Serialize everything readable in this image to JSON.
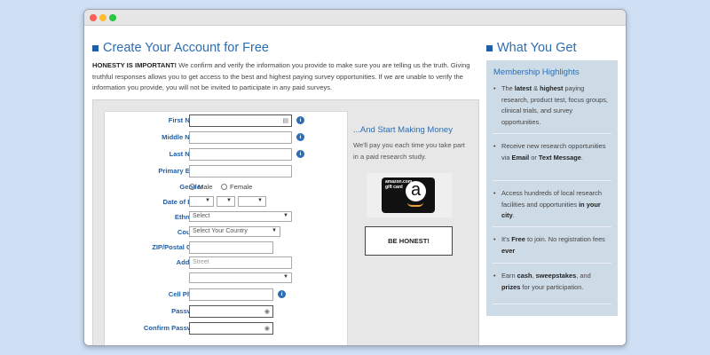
{
  "titlebar": {
    "colors": [
      "#ff5f57",
      "#febc2e",
      "#28c840"
    ]
  },
  "left_heading": "Create Your Account for Free",
  "right_heading": "What You Get",
  "honesty": {
    "bold": "HONESTY IS IMPORTANT!",
    "text": " We confirm and verify the information you provide to make sure you are telling us the truth. Giving truthful responses allows you to get access to the best and highest paying survey opportunities. If we are unable to verify the information you provide, you will not be invited to participate in any paid surveys."
  },
  "form": {
    "first_name": "First Name",
    "middle_name": "Middle Name",
    "last_name": "Last Name",
    "primary_email": "Primary Email",
    "gender": "Gender",
    "gender_male": "Male",
    "gender_female": "Female",
    "dob": "Date of Birth",
    "ethnicity": "Ethnicity",
    "ethnicity_value": "Select",
    "country": "Country",
    "country_value": "Select Your Country",
    "zip": "ZIP/Postal Code",
    "address": "Address",
    "address_placeholder": "Street",
    "cell_phone": "Cell Phone",
    "password": "Password",
    "confirm_password": "Confirm Password"
  },
  "money": {
    "title": "...And Start Making Money",
    "text": "We'll pay you each time you take part in a paid research study.",
    "giftcard_brand_top": "amazon.com",
    "giftcard_brand_bottom": "gift card",
    "giftcard_logo": "a"
  },
  "be_honest_button": "BE HONEST!",
  "sidebar": {
    "title": "Membership Highlights",
    "items": [
      {
        "t1": "The ",
        "b1": "latest",
        "t2": " & ",
        "b2": "highest",
        "t3": " paying research, product test, focus groups, clinical trials, and survey opportunities."
      },
      {
        "t1": "Receive new research opportunities via ",
        "b1": "Email",
        "t2": " or ",
        "b2": "Text Message",
        "t3": "."
      },
      {
        "t1": "Access hundreds of local research facilities and opportunities ",
        "b1": "in your city",
        "t2": ".",
        "b2": "",
        "t3": ""
      },
      {
        "t1": "It's ",
        "b1": "Free",
        "t2": " to join. No registration fees ",
        "b2": "ever",
        "t3": ""
      },
      {
        "t1": "Earn ",
        "b1": "cash",
        "t2": ", ",
        "b2": "sweepstakes",
        "t3": ", and ",
        "b3": "prizes",
        "t4": " for your participation."
      }
    ]
  }
}
